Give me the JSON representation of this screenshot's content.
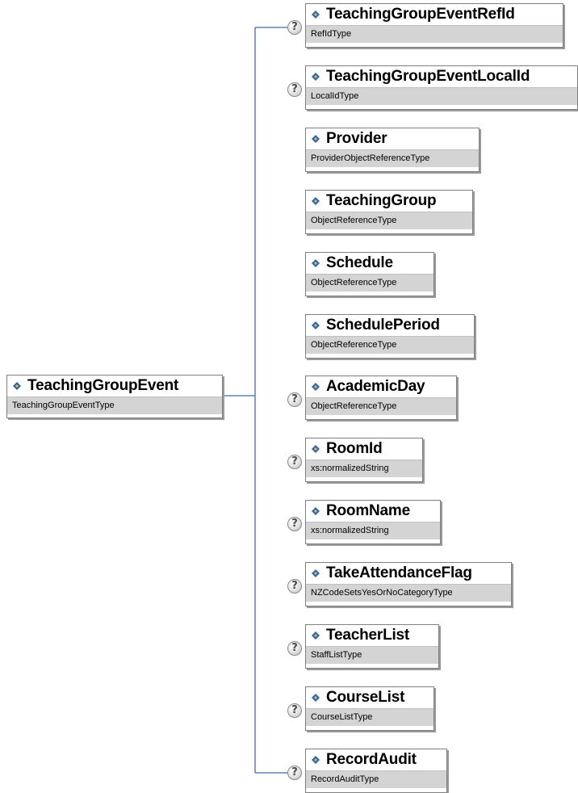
{
  "root": {
    "name": "TeachingGroupEvent",
    "type": "TeachingGroupEventType"
  },
  "children": [
    {
      "name": "TeachingGroupEventRefId",
      "type": "RefIdType",
      "optional": true
    },
    {
      "name": "TeachingGroupEventLocalId",
      "type": "LocalIdType",
      "optional": true
    },
    {
      "name": "Provider",
      "type": "ProviderObjectReferenceType",
      "optional": false
    },
    {
      "name": "TeachingGroup",
      "type": "ObjectReferenceType",
      "optional": false
    },
    {
      "name": "Schedule",
      "type": "ObjectReferenceType",
      "optional": false
    },
    {
      "name": "SchedulePeriod",
      "type": "ObjectReferenceType",
      "optional": false
    },
    {
      "name": "AcademicDay",
      "type": "ObjectReferenceType",
      "optional": true
    },
    {
      "name": "RoomId",
      "type": "xs:normalizedString",
      "optional": true
    },
    {
      "name": "RoomName",
      "type": "xs:normalizedString",
      "optional": true
    },
    {
      "name": "TakeAttendanceFlag",
      "type": "NZCodeSetsYesOrNoCategoryType",
      "optional": true
    },
    {
      "name": "TeacherList",
      "type": "StaffListType",
      "optional": true
    },
    {
      "name": "CourseList",
      "type": "CourseListType",
      "optional": true
    },
    {
      "name": "RecordAudit",
      "type": "RecordAuditType",
      "optional": true
    }
  ],
  "help_glyph": "?",
  "colors": {
    "connector": "#3b6fa3",
    "type_band": "#d4d4d4",
    "icon_blue": "#2a66c0",
    "icon_yellow": "#f2c200"
  }
}
